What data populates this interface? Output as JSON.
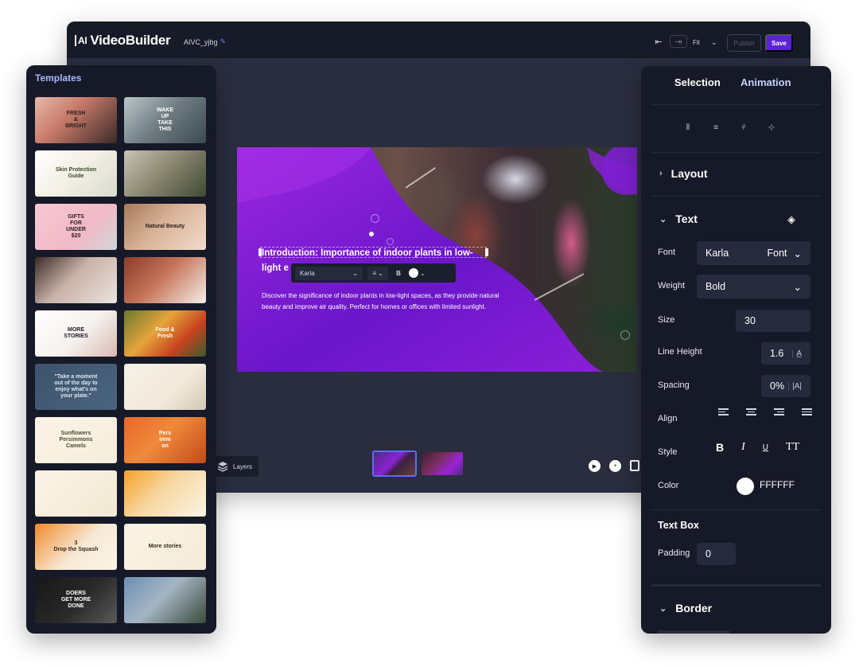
{
  "app": {
    "logo_badge": "AI",
    "logo_text": "VideoBuilder",
    "project_name": "AIVC_yjbg",
    "pen_icon": "pencil-icon",
    "fit_label": "Fit",
    "publish_label": "Publish",
    "save_label": "Save",
    "accent": "#5b22d9"
  },
  "canvas": {
    "title_line1": "Introduction: Importance of indoor plants in low-",
    "title_line2": "light e",
    "desc_line1": "Discover the significance of indoor plants in low-light spaces, as they provide natural",
    "desc_line2": "beauty and improve air quality. Perfect for homes or offices with limited sunlight.",
    "toolbar_font": "Karla",
    "toolbar_bold": "B",
    "layers_label": "Layers"
  },
  "templates": {
    "title": "Templates",
    "cards": [
      {
        "text": "FRESH\n&\nBRIGHT",
        "bg": "linear-gradient(135deg,#e6b8a9 0%,#c97b6b 40%,#3a2a27 100%)",
        "fg": "#2b1e1c"
      },
      {
        "text": "WAKE\nUP\nTAKE\nTHIS",
        "bg": "linear-gradient(135deg,#b9c5c9 0%,#6c7a7f 50%,#3d4a4f 100%)",
        "fg": "#ffffff"
      },
      {
        "text": "Skin Protection\nGuide",
        "bg": "linear-gradient(135deg,#ffffff 0%,#f3efe4 50%,#d7dccd 100%)",
        "fg": "#3a4a2a"
      },
      {
        "text": "",
        "bg": "linear-gradient(135deg,#c9c3b4 0%,#8e8a74 45%,#3f4a33 100%)",
        "fg": "#ffffff"
      },
      {
        "text": "GIFTS\nFOR\nUNDER\n$20",
        "bg": "linear-gradient(135deg,#f6c8d2 0%,#f1b9c6 60%,#cfd6d8 100%)",
        "fg": "#2b1e22"
      },
      {
        "text": "Natural Beauty",
        "bg": "linear-gradient(135deg,#a57a5a 0%,#d8b296 45%,#f2dccb 100%)",
        "fg": "#2b1e1c"
      },
      {
        "text": "",
        "bg": "linear-gradient(135deg,#3a2a25 0%,#c9b2a7 45%,#eae4df 100%)",
        "fg": "#ffffff"
      },
      {
        "text": "",
        "bg": "linear-gradient(135deg,#8a3c2a 0%,#c57458 45%,#f5efe9 100%)",
        "fg": "#ffffff"
      },
      {
        "text": "MORE\nSTORIES",
        "bg": "linear-gradient(135deg,#ffffff 0%,#f5f1ee 55%,#d9b8b0 100%)",
        "fg": "#1e1b24"
      },
      {
        "text": "Food &\nFresh",
        "bg": "linear-gradient(135deg,#6a7a2c 0%,#e6a43a 40%,#c6421f 70%,#3a5a2b 100%)",
        "fg": "#ffffff"
      },
      {
        "text": "\"Take a moment\nout of the day to\nenjoy what's on\nyour plate.\"",
        "bg": "linear-gradient(135deg,#3d536b 0%,#4a6480 100%)",
        "fg": "#dfe7ef"
      },
      {
        "text": "",
        "bg": "linear-gradient(135deg,#f7f1e6 0%,#f1e9da 60%,#d2c8b6 100%)",
        "fg": "#2a2a2a"
      },
      {
        "text": "Sunflowers\nPersimmons\nCamels",
        "bg": "linear-gradient(135deg,#fbf4e6 0%,#f5ecdb 100%)",
        "fg": "#4a4a3a"
      },
      {
        "text": "Pers\nimm\non",
        "bg": "linear-gradient(135deg,#e6672a 0%,#f08a3a 45%,#c24a1a 100%)",
        "fg": "#ffffff"
      },
      {
        "text": "",
        "bg": "linear-gradient(135deg,#fbf4e6 0%,#f2e7d3 100%)",
        "fg": "#5a3a2a"
      },
      {
        "text": "",
        "bg": "linear-gradient(135deg,#f5a028 0%,#f7d7a0 45%,#fbf4e6 100%)",
        "fg": "#3a2a1a"
      },
      {
        "text": "3\nDrop the Squash",
        "bg": "linear-gradient(135deg,#f08a2a 0%,#f7ead6 55%,#fbf4e6 100%)",
        "fg": "#3a2a1a"
      },
      {
        "text": "More stories",
        "bg": "linear-gradient(135deg,#fbf4e6 0%,#f4ead8 100%)",
        "fg": "#3a2a1a"
      },
      {
        "text": "DOERS\nGET MORE\nDONE",
        "bg": "linear-gradient(135deg,#161616 0%,#2a2a2a 55%,#5a5a5a 100%)",
        "fg": "#ffffff"
      },
      {
        "text": "",
        "bg": "linear-gradient(135deg,#6b8fb5 0%,#a5b5c5 45%,#3a4a3a 100%)",
        "fg": "#ffffff"
      }
    ]
  },
  "selection_panel": {
    "tab_selection": "Selection",
    "tab_animation": "Animation",
    "section_layout": "Layout",
    "section_text": "Text",
    "section_border": "Border",
    "font_label": "Font",
    "font_value": "Karla",
    "font_button": "Font",
    "weight_label": "Weight",
    "weight_value": "Bold",
    "size_label": "Size",
    "size_value": "30",
    "line_height_label": "Line Height",
    "line_height_value": "1.6",
    "spacing_label": "Spacing",
    "spacing_value": "0%",
    "align_label": "Align",
    "style_label": "Style",
    "style_bold": "B",
    "style_italic": "I",
    "style_underline": "U",
    "style_tt": "TT",
    "color_label": "Color",
    "color_hex": "FFFFFF",
    "text_box_label": "Text Box",
    "padding_label": "Padding",
    "padding_value": "0"
  }
}
